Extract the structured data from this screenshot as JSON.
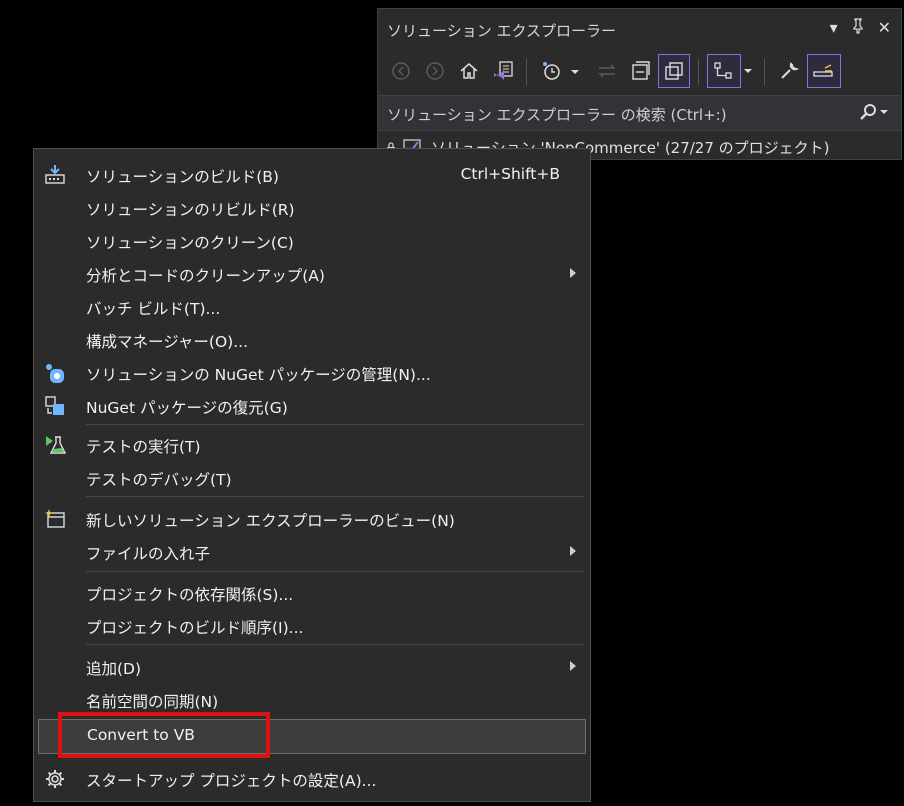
{
  "solution_explorer": {
    "title": "ソリューション エクスプローラー",
    "search_placeholder": "ソリューション エクスプローラー の検索 (Ctrl+:)",
    "root_item": "ソリューション 'NopCommerce' (27/27 のプロジェクト)",
    "toolbar_icons": [
      "back-icon",
      "forward-icon",
      "home-icon",
      "vs-switch-views-icon",
      "pending-changes-filter-icon",
      "sync-icon",
      "collapse-all-icon",
      "show-all-files-icon",
      "switch-view-icon",
      "properties-icon",
      "preview-icon"
    ]
  },
  "menu": {
    "items": [
      {
        "label": "ソリューションのビルド(B)",
        "shortcut": "Ctrl+Shift+B",
        "icon": "build-icon"
      },
      {
        "label": "ソリューションのリビルド(R)"
      },
      {
        "label": "ソリューションのクリーン(C)"
      },
      {
        "label": "分析とコードのクリーンアップ(A)",
        "submenu": true
      },
      {
        "label": "バッチ ビルド(T)..."
      },
      {
        "label": "構成マネージャー(O)..."
      },
      {
        "label": "ソリューションの NuGet パッケージの管理(N)...",
        "icon": "nuget-icon"
      },
      {
        "label": "NuGet パッケージの復元(G)",
        "icon": "restore-packages-icon"
      },
      {
        "label": "テストの実行(T)",
        "icon": "run-tests-icon"
      },
      {
        "label": "テストのデバッグ(T)"
      },
      {
        "label": "新しいソリューション エクスプローラーのビュー(N)",
        "icon": "new-view-icon"
      },
      {
        "label": "ファイルの入れ子",
        "submenu": true
      },
      {
        "label": "プロジェクトの依存関係(S)..."
      },
      {
        "label": "プロジェクトのビルド順序(I)..."
      },
      {
        "label": "追加(D)",
        "submenu": true
      },
      {
        "label": "名前空間の同期(N)"
      },
      {
        "label": "Convert to VB",
        "highlighted": true
      },
      {
        "label": "スタートアップ プロジェクトの設定(A)...",
        "icon": "gear-icon"
      }
    ]
  },
  "colors": {
    "highlight_box": "#e01010",
    "accent": "#8b6fe0"
  }
}
